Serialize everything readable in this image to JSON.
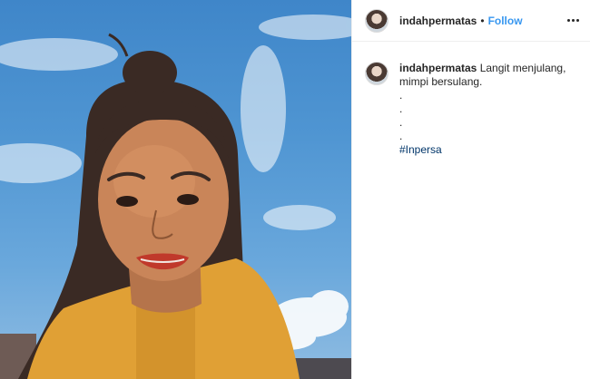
{
  "post": {
    "photo_description": "",
    "header": {
      "username": "indahpermatas",
      "separator": "•",
      "follow_label": "Follow",
      "more_icon": "more-options-icon"
    },
    "caption": {
      "username": "indahpermatas",
      "text": "Langit menjulang, mimpi bersulang.",
      "lines": [
        ".",
        ".",
        ".",
        "."
      ],
      "hashtag": "#Inpersa"
    }
  },
  "colors": {
    "link": "#3897f0",
    "hashtag": "#003569",
    "sky": "#4f95d2",
    "shirt": "#e0a035"
  }
}
